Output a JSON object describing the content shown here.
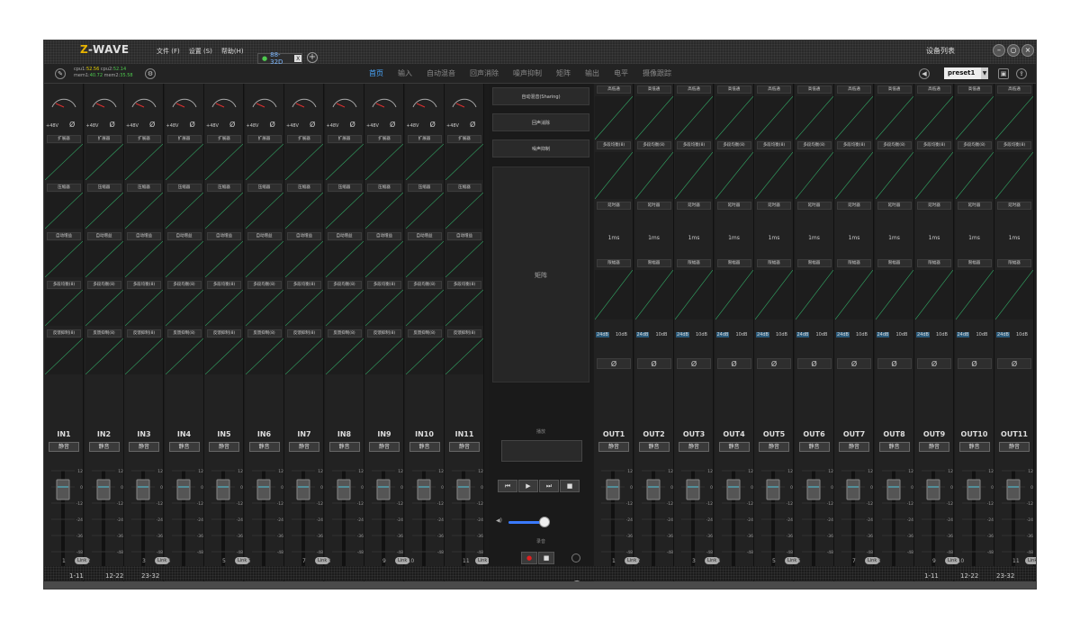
{
  "app": {
    "logo_z": "Z",
    "logo_rest": "-WAVE",
    "device_tab": "88-32D",
    "device_list": "设备列表"
  },
  "menu": [
    "文件 (F)",
    "设置 (S)",
    "帮助(H)"
  ],
  "stats": {
    "cpu1_label": "cpu1:",
    "cpu1": "52.56",
    "cpu2_label": "cpu2:",
    "cpu2": "52.14",
    "mem1_label": "mem1:",
    "mem1": "40.72",
    "mem2_label": "mem2:",
    "mem2": "35.58"
  },
  "nav_tabs": [
    "首页",
    "输入",
    "自动混音",
    "回声消除",
    "噪声抑制",
    "矩阵",
    "输出",
    "电平",
    "摄像跟踪"
  ],
  "active_tab": "首页",
  "preset": "preset1",
  "inputs": {
    "names": [
      "IN1",
      "IN2",
      "IN3",
      "IN4",
      "IN5",
      "IN6",
      "IN7",
      "IN8",
      "IN9",
      "IN10",
      "IN11"
    ],
    "phantom": "+48V",
    "phase": "Ø",
    "blocks": [
      "扩展器",
      "压缩器",
      "自动增益",
      "多段均衡(8)",
      "反馈抑制(8)"
    ]
  },
  "outputs": {
    "names": [
      "OUT1",
      "OUT2",
      "OUT3",
      "OUT4",
      "OUT5",
      "OUT6",
      "OUT7",
      "OUT8",
      "OUT9",
      "OUT10",
      "OUT11"
    ],
    "blocks": [
      "高低通",
      "多段均衡(8)",
      "延时器",
      "限幅器"
    ],
    "delay": "1ms",
    "gain_a": "24dB",
    "gain_b": "10dB",
    "phase": "Ø"
  },
  "mute": "静音",
  "fader_scale": [
    "12",
    "0",
    "-12",
    "-24",
    "-36",
    "-48",
    "-60"
  ],
  "fader_value": "0.0",
  "link": "Link",
  "middle": {
    "btn1": "自动混音(Sharing)",
    "btn2": "回声消除",
    "btn3": "噪声抑制",
    "matrix": "矩阵",
    "play": "播放",
    "record": "录音",
    "transport": [
      "⏮",
      "▶",
      "⏭",
      "■"
    ]
  },
  "banks": [
    "1-11",
    "12-22",
    "23-32"
  ],
  "colors": {
    "accent": "#4aa8ff",
    "logo": "#e8b400",
    "slider": "#3a7aff",
    "record": "#e02020"
  }
}
